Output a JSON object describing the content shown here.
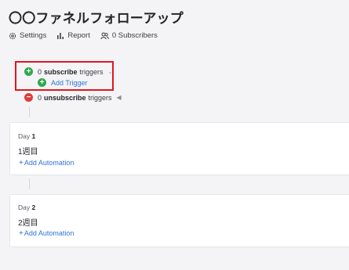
{
  "page": {
    "title": "〇〇ファネルフォローアップ"
  },
  "tabs": [
    {
      "label": "Settings",
      "icon": "gear-icon"
    },
    {
      "label": "Report",
      "icon": "bar-chart-icon"
    },
    {
      "label": "0 Subscribers",
      "icon": "users-icon"
    }
  ],
  "triggers": {
    "subscribe": {
      "count": "0",
      "keyword": "subscribe",
      "suffix": "triggers"
    },
    "add_trigger": "Add Trigger",
    "unsubscribe": {
      "count": "0",
      "keyword": "unsubscribe",
      "suffix": "triggers"
    }
  },
  "days": [
    {
      "prefix": "Day",
      "number": "1",
      "name": "1週目",
      "add_label": "Add Automation"
    },
    {
      "prefix": "Day",
      "number": "2",
      "name": "2週目",
      "add_label": "Add Automation"
    }
  ],
  "colors": {
    "accent": "#2f72d6",
    "green": "#2fa84f",
    "red": "#df3b3b",
    "highlight": "#e0161f"
  }
}
